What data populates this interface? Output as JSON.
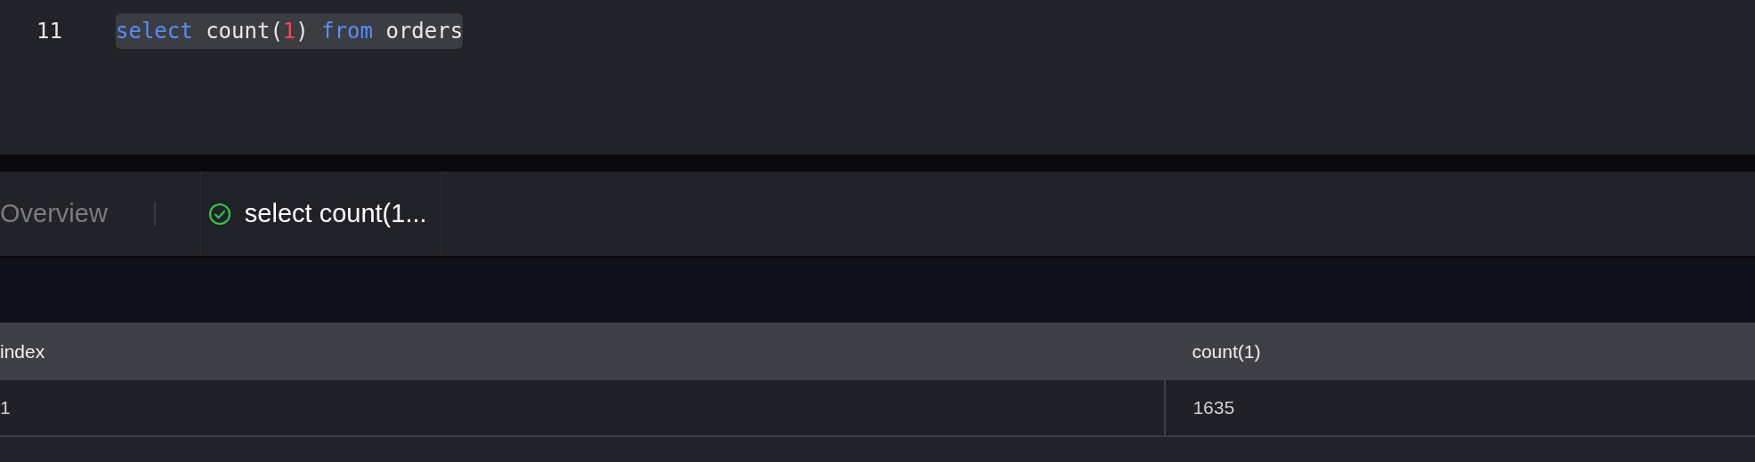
{
  "editor": {
    "lines": [
      {
        "number": "11",
        "highlighted": true,
        "tokens": [
          {
            "text": "select",
            "kind": "keyword"
          },
          {
            "text": " count(",
            "kind": "plain"
          },
          {
            "text": "1",
            "kind": "number"
          },
          {
            "text": ") ",
            "kind": "plain"
          },
          {
            "text": "from",
            "kind": "keyword"
          },
          {
            "text": " orders",
            "kind": "plain"
          }
        ]
      }
    ]
  },
  "tabs": [
    {
      "label": "Overview",
      "selected": false
    },
    {
      "label": "select count(1...",
      "selected": true,
      "succeeded": true
    }
  ],
  "table": {
    "columns": [
      "index",
      "count(1)"
    ],
    "rows": [
      [
        "1",
        "1635"
      ]
    ]
  }
}
